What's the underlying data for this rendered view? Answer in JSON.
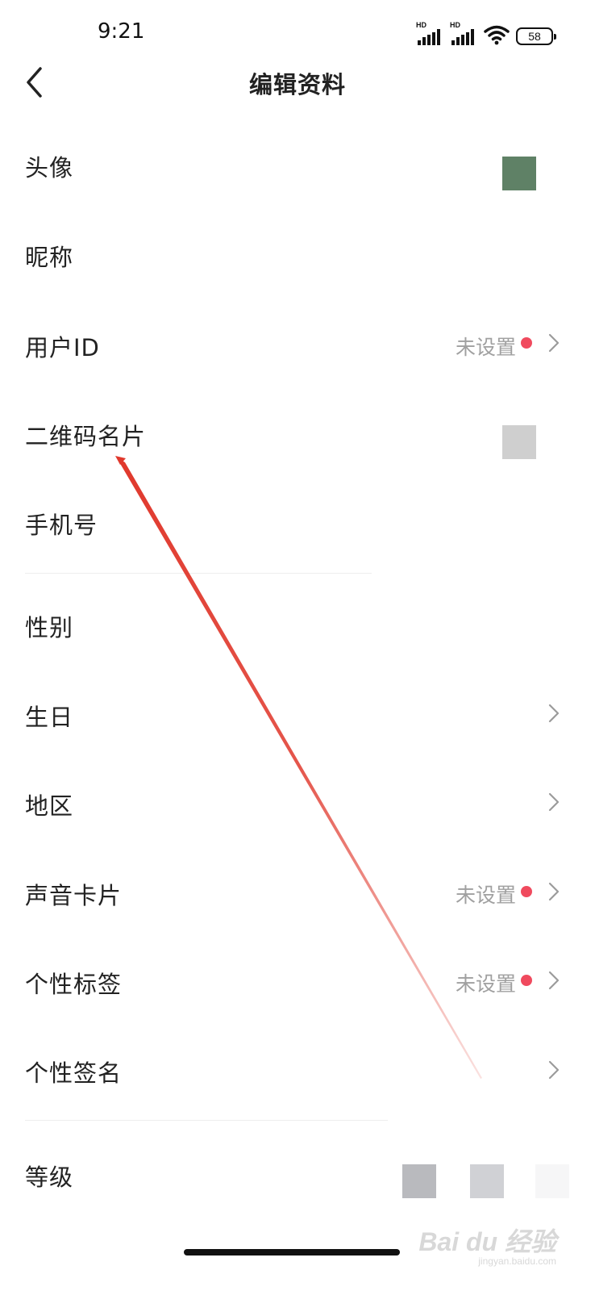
{
  "status_bar": {
    "time": "9:21",
    "signal_1_label": "HD",
    "signal_2_label": "HD",
    "battery_level": "58",
    "icons": [
      "signal-icon",
      "signal-icon",
      "wifi-icon",
      "battery-icon"
    ]
  },
  "header": {
    "title": "编辑资料",
    "back_icon": "chevron-left-icon"
  },
  "rows": {
    "avatar": {
      "label": "头像",
      "thumb_color": "#5f8166"
    },
    "nickname": {
      "label": "昵称"
    },
    "user_id": {
      "label": "用户ID",
      "value": "未设置",
      "has_red_dot": true,
      "has_chevron": true
    },
    "qr_card": {
      "label": "二维码名片",
      "thumb_color": "#cfcfcf"
    },
    "phone": {
      "label": "手机号"
    },
    "gender": {
      "label": "性别"
    },
    "birthday": {
      "label": "生日",
      "has_chevron": true
    },
    "region": {
      "label": "地区",
      "has_chevron": true
    },
    "voice_card": {
      "label": "声音卡片",
      "value": "未设置",
      "has_red_dot": true,
      "has_chevron": true
    },
    "tags": {
      "label": "个性标签",
      "value": "未设置",
      "has_red_dot": true,
      "has_chevron": true
    },
    "signature": {
      "label": "个性签名",
      "has_chevron": true
    },
    "level": {
      "label": "等级",
      "badge_colors": [
        "#b9babe",
        "#d0d1d5",
        "#f6f6f7"
      ]
    }
  },
  "colors": {
    "accent_red": "#f04a5e",
    "annotation_arrow": "#e0382c",
    "muted_text": "#a0a0a0"
  },
  "watermark": {
    "logo": "Bai du 经验",
    "url": "jingyan.baidu.com"
  }
}
